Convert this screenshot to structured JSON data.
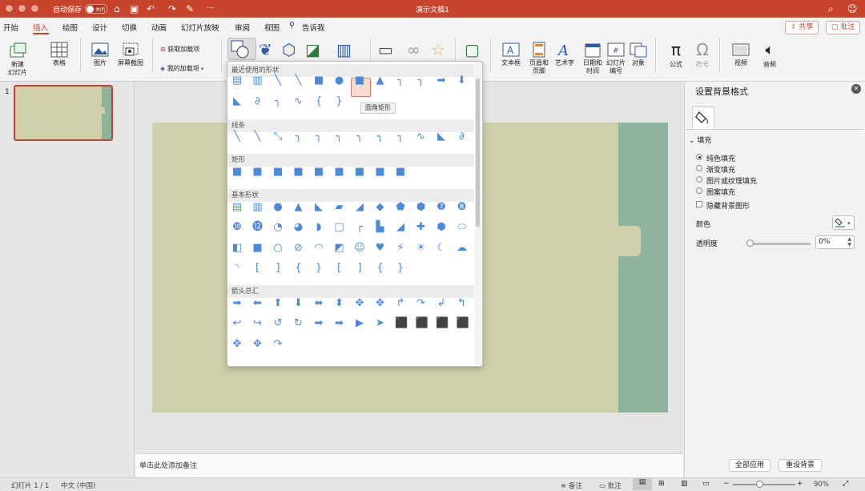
{
  "titlebar": {
    "autosave_label": "自动保存",
    "autosave_state": "关闭",
    "doc_title": "演示文稿1",
    "more": "···"
  },
  "tabs": [
    "开始",
    "插入",
    "绘图",
    "设计",
    "切换",
    "动画",
    "幻灯片放映",
    "审阅",
    "视图",
    "告诉我"
  ],
  "active_tab": "插入",
  "share_label": "共享",
  "comment_label": "批注",
  "ribbon": {
    "new_slide": "新建\n幻灯片",
    "table": "表格",
    "picture": "图片",
    "screenshot": "屏幕截图",
    "get_addins": "获取加载项",
    "my_addins": "我的加载项",
    "textbox": "文本框",
    "header_footer": "页眉和\n页脚",
    "wordart": "艺术字",
    "datetime": "日期和\n时间",
    "slide_number": "幻灯片\n编号",
    "object": "对象",
    "equation": "公式",
    "symbol": "符号",
    "video": "视频",
    "audio": "音频"
  },
  "slide_panel": {
    "slide_number": "1"
  },
  "notes_placeholder": "单击此处添加备注",
  "shapes_menu": {
    "sections": [
      "最近使用的形状",
      "线条",
      "矩形",
      "基本形状",
      "箭头总汇"
    ],
    "tooltip": "圆角矩形"
  },
  "format_pane": {
    "title": "设置背景格式",
    "fill_header": "填充",
    "fill_options": [
      "纯色填充",
      "渐变填充",
      "图片或纹理填充",
      "图案填充"
    ],
    "selected_fill": "纯色填充",
    "hide_bg_label": "隐藏背景图形",
    "color_label": "颜色",
    "transparency_label": "透明度",
    "transparency_value": "0%",
    "transparency_fraction": 0,
    "apply_all": "全部应用",
    "reset_bg": "重设背景"
  },
  "status": {
    "slide_info": "幻灯片 1 / 1",
    "language": "中文 (中国)",
    "notes": "备注",
    "comments": "批注",
    "zoom": "90%"
  },
  "colors": {
    "accent": "#c8432b",
    "slide_bg": "#cfcfaa",
    "slide_strip": "#8db29e",
    "shape_blue": "#4a89dc"
  }
}
